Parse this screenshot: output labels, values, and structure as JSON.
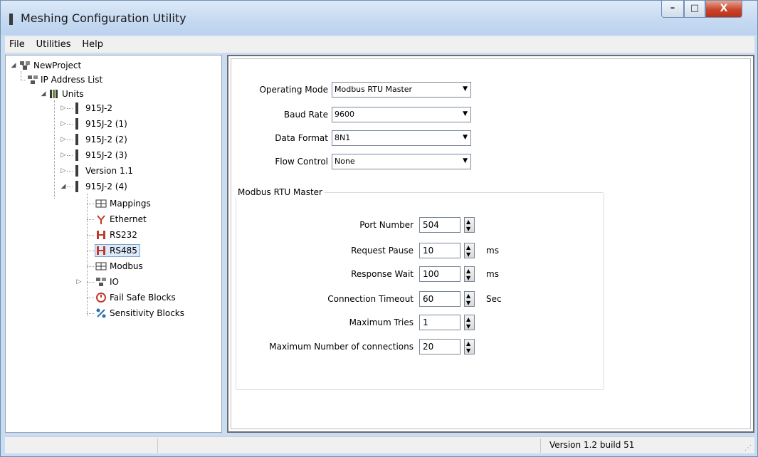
{
  "window": {
    "title": "Meshing Configuration Utility",
    "controls": {
      "minimize": "–",
      "maximize": "□",
      "close": "X"
    }
  },
  "menu": [
    "File",
    "Utilities",
    "Help"
  ],
  "tree": {
    "project": "NewProject",
    "ip_list": "IP Address List",
    "units": "Units",
    "unit_items": [
      "915J-2",
      "915J-2 (1)",
      "915J-2 (2)",
      "915J-2 (3)",
      "Version 1.1",
      "915J-2 (4)"
    ],
    "children": [
      "Mappings",
      "Ethernet",
      "RS232",
      "RS485",
      "Modbus",
      "IO",
      "Fail Safe Blocks",
      "Sensitivity Blocks"
    ],
    "selected": "RS485"
  },
  "config": {
    "operating_mode": {
      "label": "Operating Mode",
      "value": "Modbus RTU Master"
    },
    "baud_rate": {
      "label": "Baud Rate",
      "value": "9600"
    },
    "data_format": {
      "label": "Data Format",
      "value": "8N1"
    },
    "flow_control": {
      "label": "Flow Control",
      "value": "None"
    }
  },
  "group": {
    "title": "Modbus RTU Master",
    "fields": [
      {
        "label": "Port Number",
        "value": "504",
        "unit": ""
      },
      {
        "label": "Request Pause",
        "value": "10",
        "unit": "ms"
      },
      {
        "label": "Response Wait",
        "value": "100",
        "unit": "ms"
      },
      {
        "label": "Connection Timeout",
        "value": "60",
        "unit": "Sec"
      },
      {
        "label": "Maximum Tries",
        "value": "1",
        "unit": ""
      },
      {
        "label": "Maximum Number of connections",
        "value": "20",
        "unit": ""
      }
    ]
  },
  "status": {
    "version": "Version 1.2 build 51"
  },
  "colors": {
    "title_bar": "#c5d9f1",
    "close_button": "#c9452a",
    "selection": "#dceaf9"
  }
}
